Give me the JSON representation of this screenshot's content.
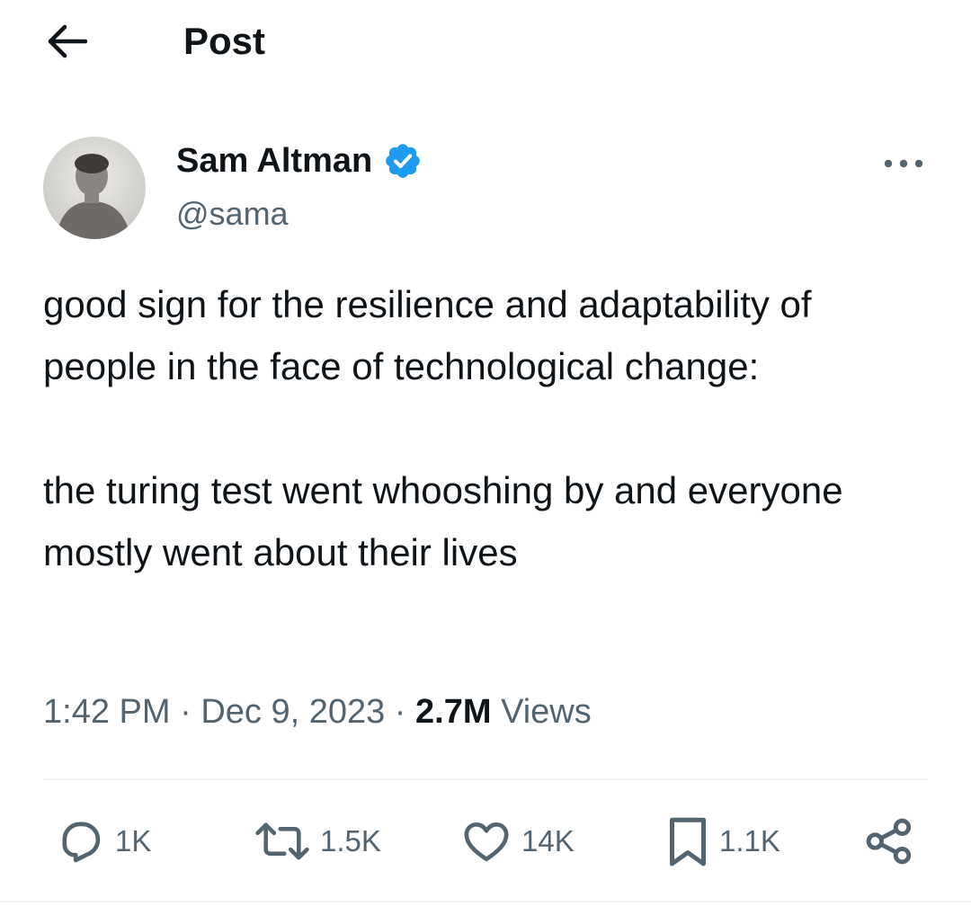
{
  "header": {
    "title": "Post"
  },
  "author": {
    "name": "Sam Altman",
    "handle": "@sama",
    "verified": true
  },
  "tweet": {
    "paragraphs": [
      "good sign for the resilience and adaptability of people in the face of technological change:",
      "the turing test went whooshing by and everyone mostly went about their lives"
    ]
  },
  "meta": {
    "time": "1:42 PM",
    "separator": "·",
    "date": "Dec 9, 2023",
    "views_count": "2.7M",
    "views_label": "Views"
  },
  "actions": {
    "replies": "1K",
    "reposts": "1.5K",
    "likes": "14K",
    "bookmarks": "1.1K"
  },
  "icons": {
    "back": "arrow-left-icon",
    "verified": "verified-badge-icon",
    "more": "more-horizontal-icon",
    "reply": "reply-icon",
    "repost": "repost-icon",
    "like": "heart-icon",
    "bookmark": "bookmark-icon",
    "share": "share-icon"
  },
  "colors": {
    "text_primary": "#0f1419",
    "text_secondary": "#536471",
    "verified_blue": "#1d9bf0",
    "divider": "#eff3f4"
  }
}
